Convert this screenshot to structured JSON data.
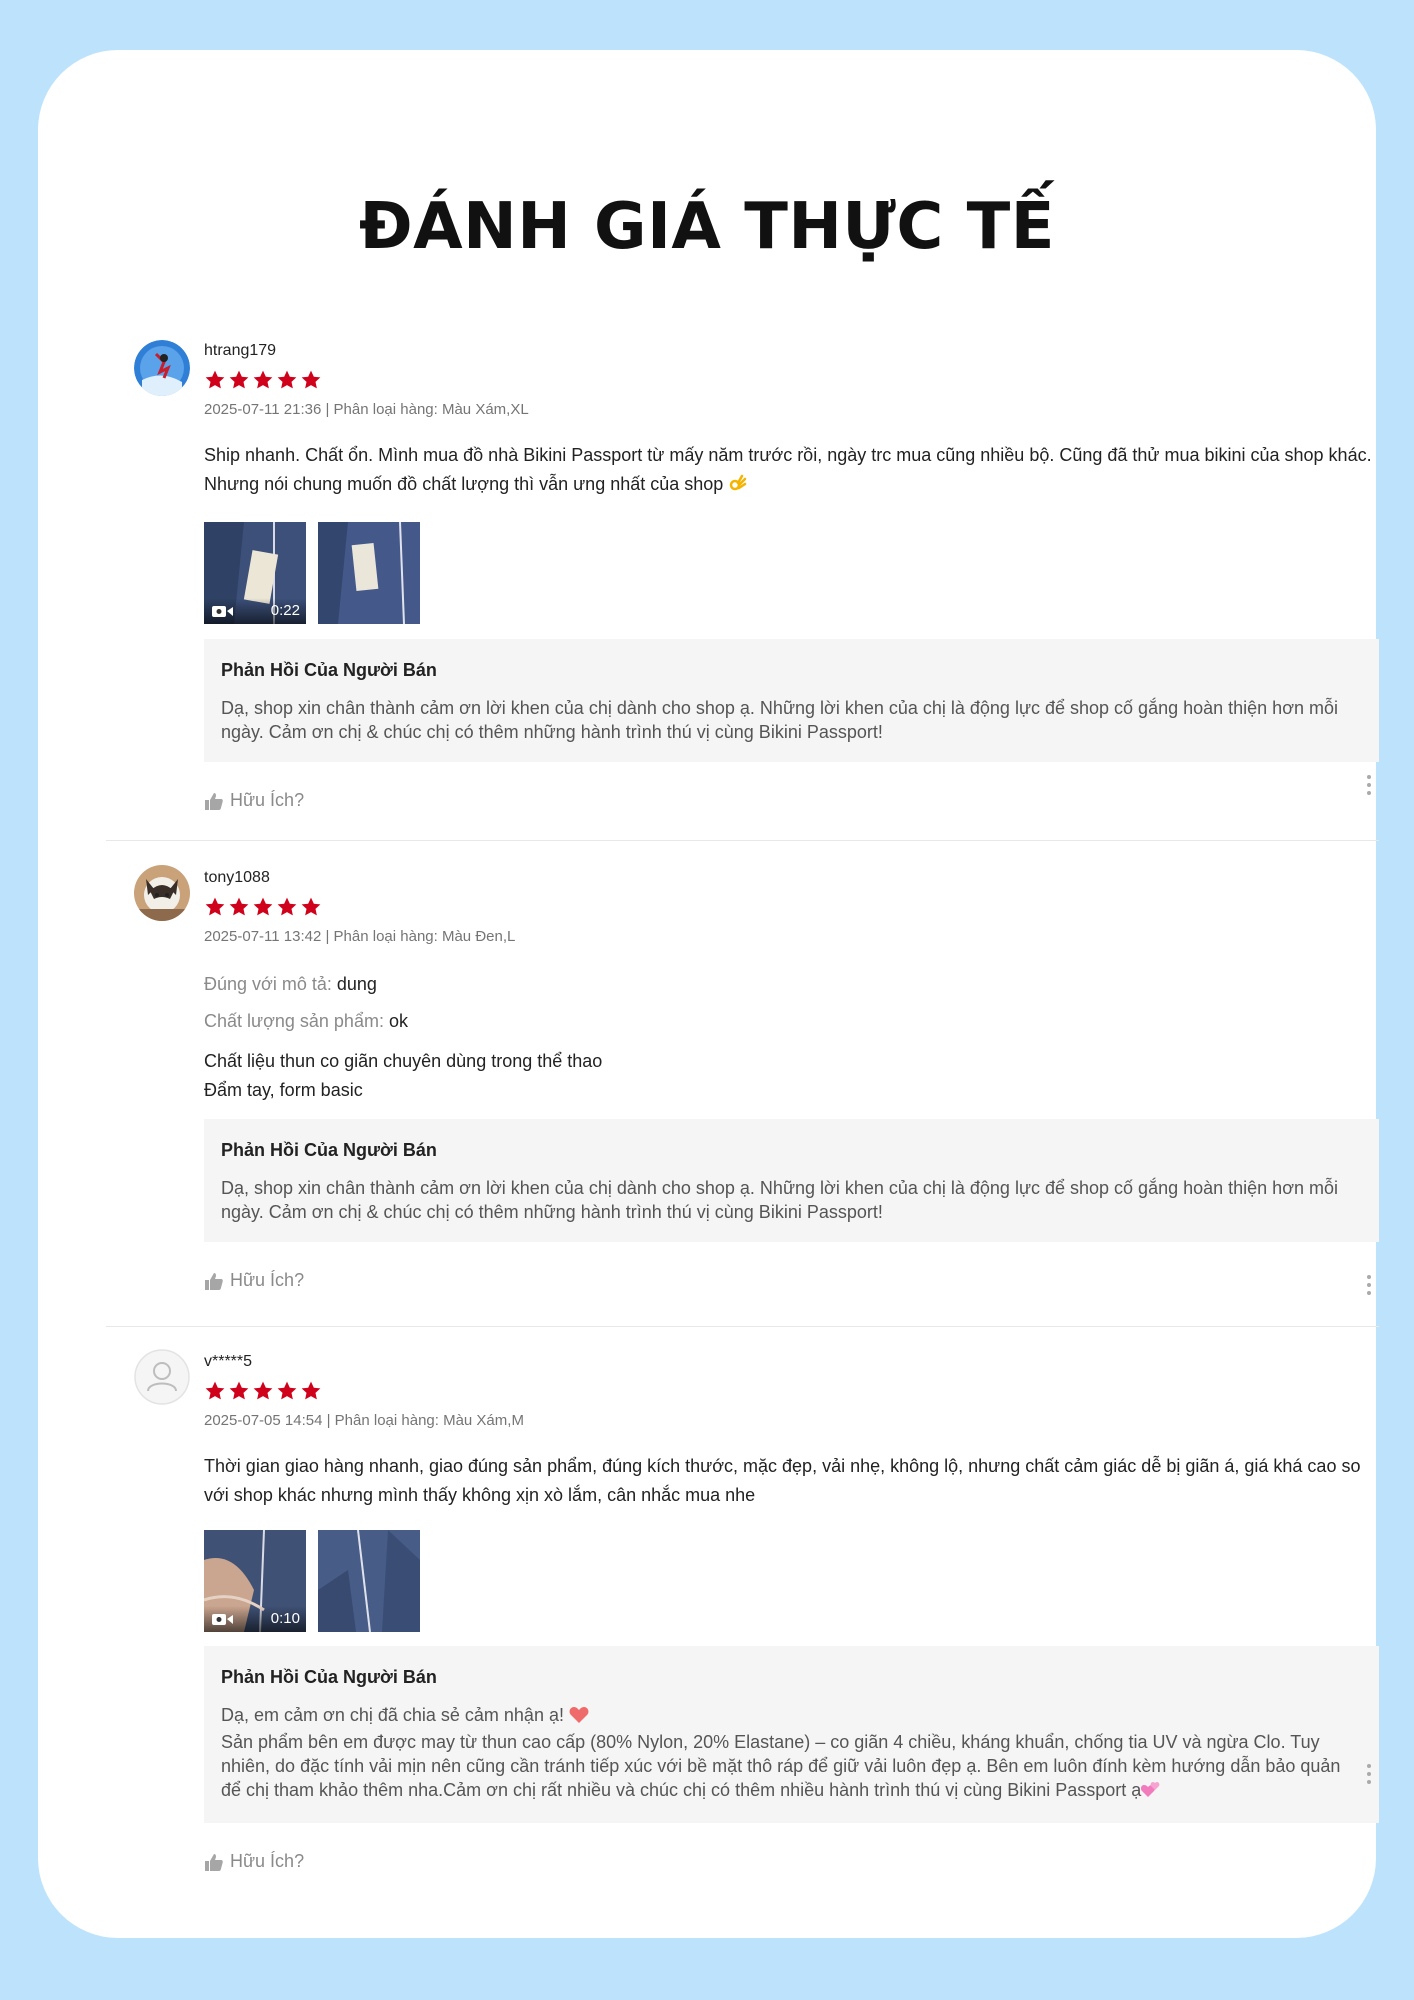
{
  "page_title": "ĐÁNH GIÁ THỰC TẾ",
  "colors": {
    "background": "#bde3fc",
    "star": "#d0011b",
    "reply_bg": "#f5f5f5"
  },
  "reviews": [
    {
      "username": "htrang179",
      "rating": 5,
      "meta": "2025-07-11 21:36 | Phân loại hàng: Màu Xám,XL",
      "attributes": [],
      "content": "Ship nhanh. Chất ổn. Mình mua đồ nhà Bikini Passport từ mấy năm trước rồi, ngày trc mua cũng nhiều bộ. Cũng đã thử mua bikini của shop khác. Nhưng nói chung muốn đồ chất lượng thì vẫn ưng nhất của shop",
      "content_emoji": "ok-hand-icon",
      "media": [
        {
          "type": "video",
          "duration": "0:22"
        },
        {
          "type": "image"
        }
      ],
      "reply_title": "Phản Hồi Của Người Bán",
      "reply_text": "Dạ, shop xin chân thành cảm ơn lời khen của chị dành cho shop ạ. Những lời khen của chị là động lực để shop cố gắng hoàn thiện hơn mỗi ngày. Cảm ơn chị & chúc chị có thêm những hành trình thú vị cùng Bikini Passport!",
      "helpful_label": "Hữu Ích?"
    },
    {
      "username": "tony1088",
      "rating": 5,
      "meta": "2025-07-11 13:42 | Phân loại hàng: Màu Đen,L",
      "attributes": [
        {
          "key": "Đúng với mô tả:",
          "value": "dung"
        },
        {
          "key": "Chất lượng sản phẩm:",
          "value": "ok"
        }
      ],
      "content_lines": [
        "Chất liệu thun co giãn chuyên dùng trong thể thao",
        "Đẩm tay, form basic"
      ],
      "media": [],
      "reply_title": "Phản Hồi Của Người Bán",
      "reply_text": "Dạ, shop xin chân thành cảm ơn lời khen của chị dành cho shop ạ. Những lời khen của chị là động lực để shop cố gắng hoàn thiện hơn mỗi ngày. Cảm ơn chị & chúc chị có thêm những hành trình thú vị cùng Bikini Passport!",
      "helpful_label": "Hữu Ích?"
    },
    {
      "username": "v*****5",
      "rating": 5,
      "meta": "2025-07-05 14:54 | Phân loại hàng: Màu Xám,M",
      "attributes": [],
      "content": "Thời gian giao hàng nhanh, giao đúng sản phẩm, đúng kích thước, mặc đẹp, vải nhẹ, không lộ, nhưng chất cảm giác dễ bị giãn á, giá khá cao so với shop khác nhưng mình thấy không xịn xò lắm, cân nhắc mua nhe",
      "media": [
        {
          "type": "video",
          "duration": "0:10"
        },
        {
          "type": "image"
        }
      ],
      "reply_title": "Phản Hồi Của Người Bán",
      "reply_line1": "Dạ, em cảm ơn chị đã chia sẻ cảm nhận ạ!",
      "reply_line1_emoji": "heart-icon",
      "reply_line2": "Sản phẩm bên em được may từ thun cao cấp (80% Nylon, 20% Elastane) – co giãn 4 chiều, kháng khuẩn, chống tia UV và ngừa Clo. Tuy nhiên, do đặc tính vải mịn nên cũng cần tránh tiếp xúc với bề mặt thô ráp để giữ vải luôn đẹp ạ. Bên em luôn đính kèm hướng dẫn bảo quản để chị tham khảo thêm nha.Cảm ơn chị rất nhiều và chúc chị có thêm nhiều hành trình thú vị cùng Bikini Passport ạ",
      "reply_line2_emoji": "hearts-icon",
      "helpful_label": "Hữu Ích?"
    }
  ]
}
